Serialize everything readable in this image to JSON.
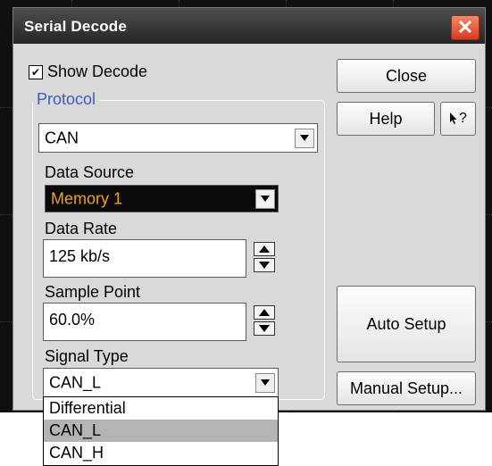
{
  "window": {
    "title": "Serial Decode",
    "close_glyph": "✕"
  },
  "show_decode": {
    "label": "Show Decode",
    "checked": true,
    "check_glyph": "✔"
  },
  "protocol": {
    "group_label": "Protocol",
    "value": "CAN"
  },
  "data_source": {
    "label": "Data Source",
    "value": "Memory 1"
  },
  "data_rate": {
    "label": "Data Rate",
    "value": "125 kb/s"
  },
  "sample_point": {
    "label": "Sample Point",
    "value": "60.0%"
  },
  "signal_type": {
    "label": "Signal Type",
    "value": "CAN_L",
    "options": [
      "Differential",
      "CAN_L",
      "CAN_H"
    ],
    "highlighted_index": 1
  },
  "buttons": {
    "close": "Close",
    "help": "Help",
    "whats_this_glyph": "?",
    "auto_setup": "Auto Setup",
    "manual_setup": "Manual Setup..."
  },
  "colors": {
    "title_bar": "#3a3a3a",
    "dialog_bg": "#d9d9d9",
    "group_label": "#3a5dbf",
    "data_source_text": "#f0a020",
    "close_button": "#d8391e"
  }
}
